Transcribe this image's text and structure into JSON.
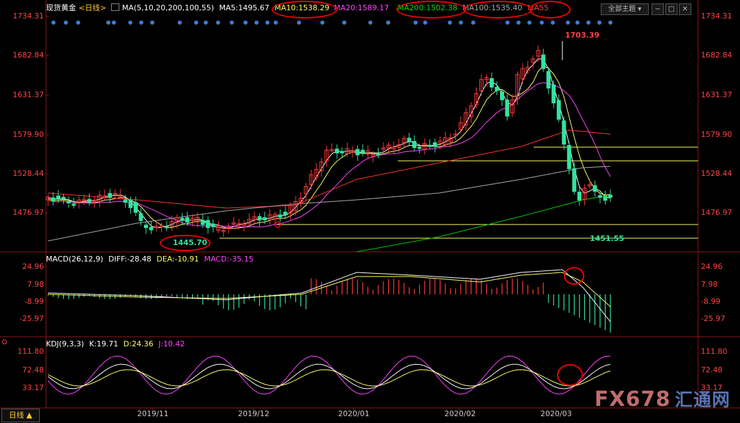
{
  "header": {
    "instrument": "现货黄金",
    "period_tag": "<日线>",
    "ma_title": "MA(5,10,20,200,100,55)",
    "ma5": "MA5:1495.67",
    "ma10": "MA10:1538.29",
    "ma20": "MA20:1589.17",
    "ma200": "MA200:1502.38",
    "ma100": "MA100:1535.40",
    "ma55": "MA55",
    "theme_select": "全部主题",
    "ctrl_minus": "−",
    "ctrl_restore": "□",
    "ctrl_close": "✕"
  },
  "price_axis": [
    "1734.31",
    "1682.84",
    "1631.37",
    "1579.90",
    "1528.44",
    "1476.97"
  ],
  "annotations": {
    "high": "1703.39",
    "low_left": "1445.70",
    "low_right": "1451.55"
  },
  "macd": {
    "title": "MACD(26,12,9)",
    "diff": "DIFF:-28.48",
    "dea": "DEA:-10.91",
    "macd": "MACD:-35.15",
    "axis": [
      "24.96",
      "7.98",
      "-8.99",
      "-25.97"
    ]
  },
  "kdj": {
    "title": "KDJ(9,3,3)",
    "k": "K:19.71",
    "d": "D:24.36",
    "j": "J:10.42",
    "axis": [
      "111.80",
      "72.48",
      "33.17"
    ]
  },
  "x_axis": [
    "2019/11",
    "2019/12",
    "2020/01",
    "2020/02",
    "2020/03"
  ],
  "period_button": "日线 ▲",
  "watermark": {
    "brand": "FX678",
    "cn": "汇通网"
  },
  "colors": {
    "up": "#ff3a3a",
    "down": "#33e3a0",
    "ma5": "#ffffff",
    "ma10": "#ffff66",
    "ma20": "#ff44ff",
    "ma200": "#00cc00",
    "ma100": "#aaaaaa",
    "ma55": "#ff3333",
    "axis_text": "#ff4444",
    "highlight": "#ee0000"
  },
  "chart_data": {
    "type": "candlestick",
    "price_ylim": [
      1445.7,
      1734.31
    ],
    "events": [
      {
        "date": "2019/11 mid",
        "low": 1445.7
      },
      {
        "date": "2020/03 early",
        "high": 1703.39
      },
      {
        "date": "2020/03 mid",
        "low": 1451.55
      }
    ],
    "macd_ylim": [
      -25.97,
      24.96
    ],
    "kdj_ylim": [
      33.17,
      111.8
    ]
  }
}
